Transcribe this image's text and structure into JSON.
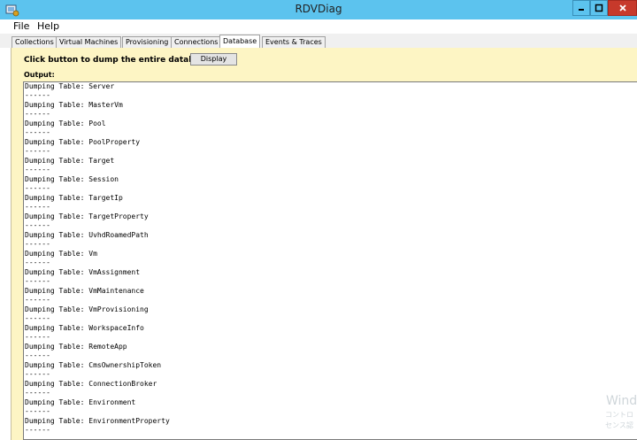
{
  "window": {
    "title": "RDVDiag"
  },
  "menu": [
    {
      "label": "File"
    },
    {
      "label": "Help"
    }
  ],
  "tabs": [
    {
      "label": "Collections"
    },
    {
      "label": "Virtual Machines"
    },
    {
      "label": "Provisioning"
    },
    {
      "label": "Connections"
    },
    {
      "label": "Database"
    },
    {
      "label": "Events & Traces"
    }
  ],
  "database": {
    "prompt": "Click button to dump the entire database",
    "button_label": "Display",
    "output_label": "Output:"
  },
  "output_lines": [
    "Dumping Table: Server",
    "------",
    "Dumping Table: MasterVm",
    "------",
    "Dumping Table: Pool",
    "------",
    "Dumping Table: PoolProperty",
    "------",
    "Dumping Table: Target",
    "------",
    "Dumping Table: Session",
    "------",
    "Dumping Table: TargetIp",
    "------",
    "Dumping Table: TargetProperty",
    "------",
    "Dumping Table: UvhdRoamedPath",
    "------",
    "Dumping Table: Vm",
    "------",
    "Dumping Table: VmAssignment",
    "------",
    "Dumping Table: VmMaintenance",
    "------",
    "Dumping Table: VmProvisioning",
    "------",
    "Dumping Table: WorkspaceInfo",
    "------",
    "Dumping Table: RemoteApp",
    "------",
    "Dumping Table: CmsOwnershipToken",
    "------",
    "Dumping Table: ConnectionBroker",
    "------",
    "Dumping Table: Environment",
    "------",
    "Dumping Table: EnvironmentProperty",
    "------"
  ],
  "watermark": {
    "line1": "Wind",
    "line2": "コントロ",
    "line3": "センス認"
  }
}
